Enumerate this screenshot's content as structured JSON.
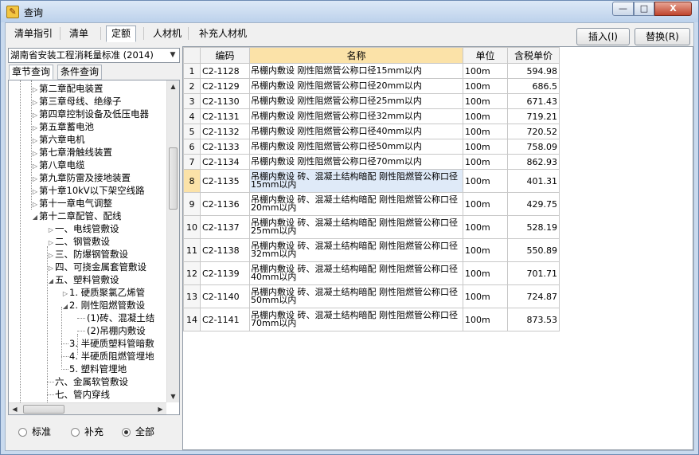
{
  "window": {
    "title": "查询",
    "icon": "app-icon",
    "controls": {
      "minimize": "—",
      "maximize": "□",
      "close": "X"
    }
  },
  "tabs": [
    "清单指引",
    "清单",
    "定额",
    "人材机",
    "补充人材机"
  ],
  "buttons": {
    "insert": "插入(I)",
    "replace": "替换(R)"
  },
  "library": {
    "selected": "湖南省安装工程消耗量标准 (2014)"
  },
  "subtabs": [
    "章节查询",
    "条件查询"
  ],
  "tree": [
    "第二章配电装置",
    "第三章母线、绝缘子",
    "第四章控制设备及低压电器",
    "第五章蓄电池",
    "第六章电机",
    "第七章滑触线装置",
    "第八章电缆",
    "第九章防雷及接地装置",
    "第十章10kV以下架空线路",
    "第十一章电气调整",
    "第十二章配管、配线",
    "一、电线管敷设",
    "二、钢管敷设",
    "三、防爆钢管敷设",
    "四、可挠金属套管敷设",
    "五、塑料管敷设",
    "1. 硬质聚氯乙烯管",
    "2. 刚性阻燃管敷设",
    "(1)砖、混凝土结",
    "(2)吊棚内敷设",
    "3. 半硬质塑料管暗敷",
    "4. 半硬质阻燃管埋地",
    "5. 塑料管埋地",
    "六、金属软管敷设",
    "七、管内穿线"
  ],
  "radios": {
    "options": [
      "标准",
      "补充",
      "全部"
    ],
    "selected": "全部"
  },
  "table": {
    "headers": [
      "",
      "编码",
      "名称",
      "单位",
      "含税单价"
    ],
    "rows": [
      [
        "1",
        "C2-1128",
        "吊棚内敷设 刚性阻燃管公称口径15mm以内",
        "100m",
        "594.98"
      ],
      [
        "2",
        "C2-1129",
        "吊棚内敷设 刚性阻燃管公称口径20mm以内",
        "100m",
        "686.5"
      ],
      [
        "3",
        "C2-1130",
        "吊棚内敷设 刚性阻燃管公称口径25mm以内",
        "100m",
        "671.43"
      ],
      [
        "4",
        "C2-1131",
        "吊棚内敷设 刚性阻燃管公称口径32mm以内",
        "100m",
        "719.21"
      ],
      [
        "5",
        "C2-1132",
        "吊棚内敷设 刚性阻燃管公称口径40mm以内",
        "100m",
        "720.52"
      ],
      [
        "6",
        "C2-1133",
        "吊棚内敷设 刚性阻燃管公称口径50mm以内",
        "100m",
        "758.09"
      ],
      [
        "7",
        "C2-1134",
        "吊棚内敷设 刚性阻燃管公称口径70mm以内",
        "100m",
        "862.93"
      ],
      [
        "8",
        "C2-1135",
        "吊棚内敷设 砖、混凝土结构暗配 刚性阻燃管公称口径15mm以内",
        "100m",
        "401.31"
      ],
      [
        "9",
        "C2-1136",
        "吊棚内敷设 砖、混凝土结构暗配 刚性阻燃管公称口径20mm以内",
        "100m",
        "429.75"
      ],
      [
        "10",
        "C2-1137",
        "吊棚内敷设 砖、混凝土结构暗配 刚性阻燃管公称口径25mm以内",
        "100m",
        "528.19"
      ],
      [
        "11",
        "C2-1138",
        "吊棚内敷设 砖、混凝土结构暗配 刚性阻燃管公称口径32mm以内",
        "100m",
        "550.89"
      ],
      [
        "12",
        "C2-1139",
        "吊棚内敷设 砖、混凝土结构暗配 刚性阻燃管公称口径40mm以内",
        "100m",
        "701.71"
      ],
      [
        "13",
        "C2-1140",
        "吊棚内敷设 砖、混凝土结构暗配 刚性阻燃管公称口径50mm以内",
        "100m",
        "724.87"
      ],
      [
        "14",
        "C2-1141",
        "吊棚内敷设 砖、混凝土结构暗配 刚性阻燃管公称口径70mm以内",
        "100m",
        "873.53"
      ]
    ],
    "selected_row": "8"
  },
  "colors": {
    "header_highlight": "#fbe2a8",
    "title_bar": "#c9daee",
    "selected_cell": "#dfeaf8"
  }
}
